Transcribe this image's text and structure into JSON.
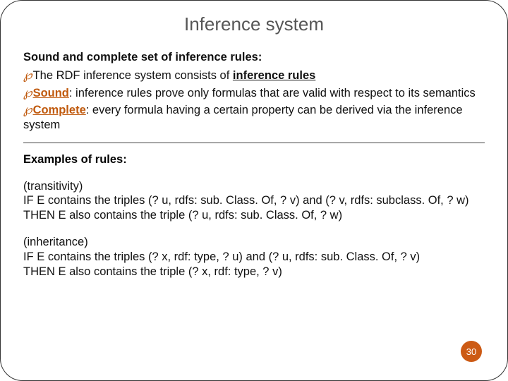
{
  "title": "Inference system",
  "section_heading": "Sound and complete set of inference rules:",
  "bullets": {
    "b1_pre": "The RDF inference system consists of ",
    "b1_key": "inference rules",
    "b2_key": "Sound",
    "b2_rest": ": inference rules prove only formulas that are valid with respect to its semantics",
    "b3_key": "Complete",
    "b3_rest": ": every formula having a certain property can be derived via the inference system"
  },
  "examples_heading": "Examples of rules:",
  "rule1": {
    "name": "(transitivity)",
    "line1": "IF E contains the triples (? u, rdfs: sub. Class. Of, ? v) and (? v, rdfs: subclass. Of, ? w)",
    "line2": "THEN E also contains the triple (? u, rdfs: sub. Class. Of, ? w)"
  },
  "rule2": {
    "name": "(inheritance)",
    "line1": "IF E contains the triples (? x, rdf: type, ? u) and (? u, rdfs: sub. Class. Of, ? v)",
    "line2": "THEN E also contains the triple (? x, rdf: type, ? v)"
  },
  "page_number": "30"
}
